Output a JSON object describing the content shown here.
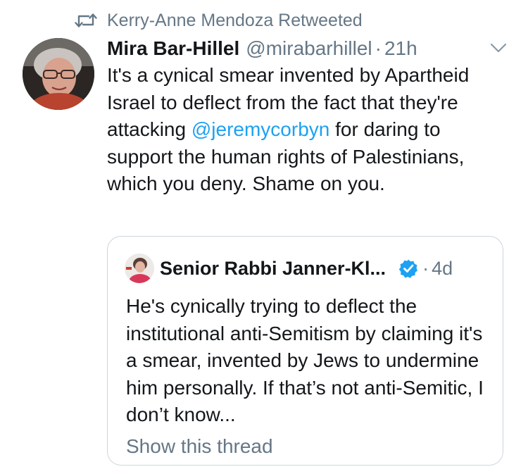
{
  "retweet": {
    "label": "Kerry-Anne Mendoza Retweeted",
    "icon": "retweet-icon"
  },
  "tweet": {
    "author_name": "Mira Bar-Hillel",
    "author_handle": "@mirabarhillel",
    "separator": "·",
    "time": "21h",
    "text_before": "It's a cynical smear invented by Apartheid Israel to deflect from the fact that they're attacking ",
    "mention": "@jeremycorbyn",
    "text_after": " for daring to support the human rights of Palestinians, which you deny. Shame on you.",
    "menu_icon": "chevron-down-icon"
  },
  "quote": {
    "author_name": "Senior Rabbi Janner-Kl...",
    "verified_icon": "verified-badge-icon",
    "separator": "·",
    "time": "4d",
    "text": "He's cynically trying to deflect the institutional anti-Semitism by claiming it's a smear, invented by Jews to undermine him personally. If that’s not anti-Semitic, I don’t know...",
    "show_thread": "Show this thread"
  },
  "colors": {
    "text": "#14171a",
    "secondary": "#657786",
    "link": "#1da1f2",
    "border": "#ccd6dd"
  }
}
